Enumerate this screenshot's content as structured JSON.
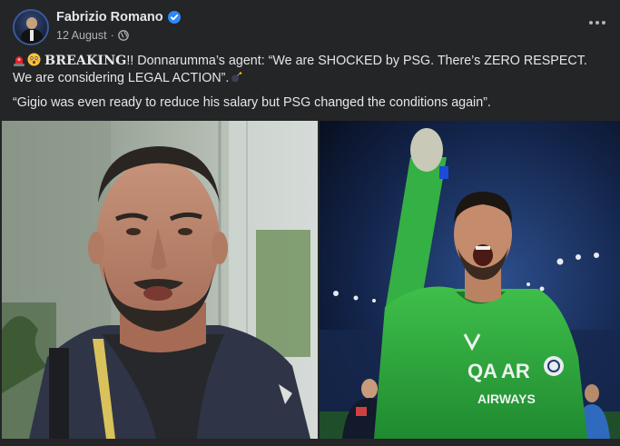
{
  "post": {
    "author": "Fabrizio Romano",
    "date": "12 August",
    "separator": "·",
    "text_breaking": "BREAKING",
    "text_line1_rest": "!! Donnarumma’s agent: “We are SHOCKED by PSG. There’s ZERO RESPECT. We are considering LEGAL ACTION”.",
    "text_line2": "“Gigio was even ready to reduce his salary but PSG changed the conditions again”.",
    "icons": {
      "verified": "verified-badge-icon",
      "audience": "globe-icon",
      "more": "more-options-icon",
      "emoji1": "siren-emoji",
      "emoji2": "shocked-face-emoji",
      "emoji3": "bomb-emoji"
    },
    "images": [
      {
        "name": "agent-photo"
      },
      {
        "name": "goalkeeper-photo",
        "shirt_text": "QATAR AIRWAYS"
      }
    ],
    "colors": {
      "background": "#242526",
      "text": "#e4e6eb",
      "muted": "#b0b3b8",
      "verified": "#2d88ff"
    }
  }
}
